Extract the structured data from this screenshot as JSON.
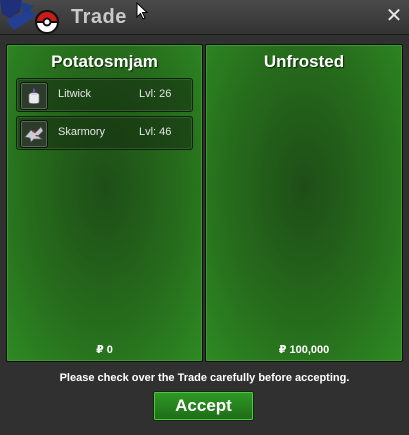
{
  "window": {
    "title": "Trade"
  },
  "left_panel": {
    "player_name": "Potatosmjam",
    "currency_symbol": "₽",
    "money": "0",
    "items": [
      {
        "name": "Litwick",
        "level": "Lvl: 26",
        "icon": "litwick-icon"
      },
      {
        "name": "Skarmory",
        "level": "Lvl: 46",
        "icon": "skarmory-icon"
      }
    ]
  },
  "right_panel": {
    "player_name": "Unfrosted",
    "currency_symbol": "₽",
    "money": "100,000"
  },
  "footer": {
    "notice": "Please check over the Trade carefully before accepting.",
    "accept_label": "Accept"
  },
  "colors": {
    "panel_green": "#266b1c",
    "accept_green": "#2f9a25",
    "titlebar": "#3a3a3a"
  }
}
